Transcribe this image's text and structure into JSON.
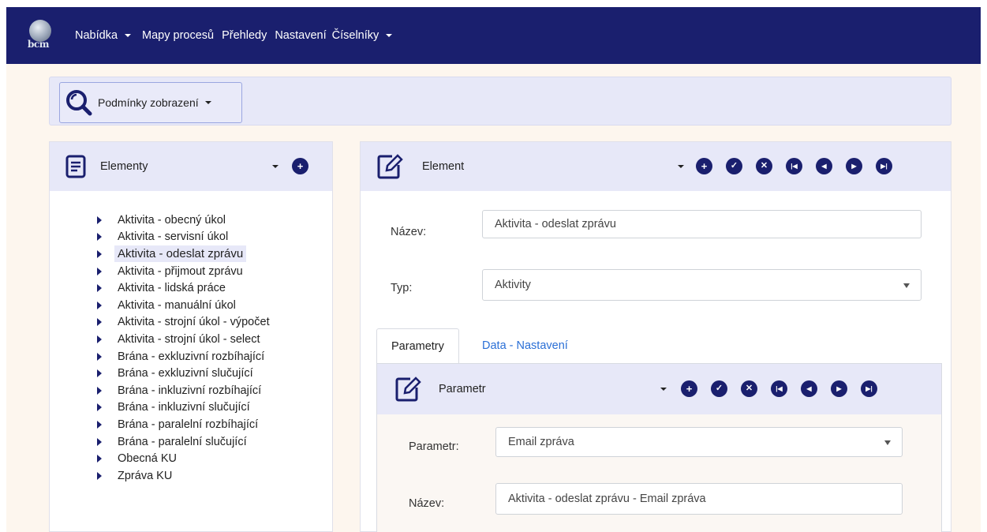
{
  "nav": {
    "logo_text": "bcm",
    "items": [
      {
        "label": "Nabídka",
        "dropdown": true
      },
      {
        "label": "Mapy procesů",
        "dropdown": false
      },
      {
        "label": "Přehledy",
        "dropdown": false
      },
      {
        "label": "Nastavení",
        "dropdown": false
      },
      {
        "label": "Číselníky",
        "dropdown": true
      }
    ]
  },
  "conditions": {
    "label": "Podmínky zobrazení"
  },
  "elements_panel": {
    "title": "Elementy",
    "items": [
      "Aktivita - obecný úkol",
      "Aktivita - servisní úkol",
      "Aktivita - odeslat zprávu",
      "Aktivita - přijmout zprávu",
      "Aktivita - lidská práce",
      "Aktivita - manuální úkol",
      "Aktivita - strojní úkol - výpočet",
      "Aktivita - strojní úkol - select",
      "Brána - exkluzivní rozbíhající",
      "Brána - exkluzivní slučující",
      "Brána - inkluzivní rozbíhající",
      "Brána - inkluzivní slučující",
      "Brána - paralelní rozbíhající",
      "Brána - paralelní slučující",
      "Obecná KU",
      "Zpráva KU"
    ],
    "selected_index": 2
  },
  "element_panel": {
    "title": "Element",
    "name_label": "Název:",
    "name_value": "Aktivita - odeslat zprávu",
    "type_label": "Typ:",
    "type_value": "Aktivity",
    "tabs": [
      "Parametry",
      "Data - Nastavení"
    ],
    "active_tab": 0
  },
  "parameter_panel": {
    "title": "Parametr",
    "param_label": "Parametr:",
    "param_value": "Email zpráva",
    "name_label": "Název:",
    "name_value": "Aktivita - odeslat zprávu - Email zpráva"
  },
  "colors": {
    "navbar": "#1a1f6e",
    "panel_header": "#e7e8f8",
    "background": "#fdf6ee",
    "link": "#2a6fd6"
  }
}
